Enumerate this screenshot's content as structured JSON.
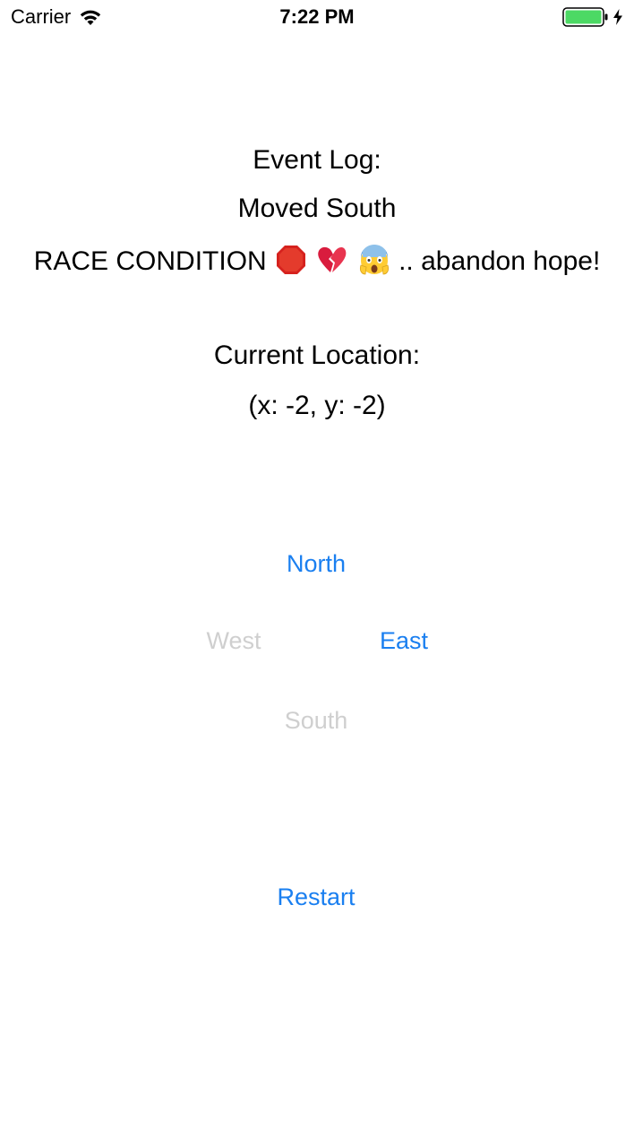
{
  "status_bar": {
    "carrier": "Carrier",
    "time": "7:22 PM",
    "icons": [
      "wifi-icon",
      "battery-icon",
      "charging-bolt-icon"
    ],
    "battery_color": "#4cd964"
  },
  "event_log": {
    "heading": "Event Log:",
    "entries": [
      "Moved South",
      {
        "before": "RACE CONDITION",
        "emojis": [
          "stop-sign-emoji",
          "broken-heart-emoji",
          "screaming-face-emoji"
        ],
        "after": ".. abandon hope!"
      }
    ]
  },
  "location": {
    "heading": "Current Location:",
    "value": "(x: -2, y: -2)"
  },
  "controls": {
    "north": {
      "label": "North",
      "enabled": true
    },
    "west": {
      "label": "West",
      "enabled": false
    },
    "east": {
      "label": "East",
      "enabled": true
    },
    "south": {
      "label": "South",
      "enabled": false
    },
    "restart": {
      "label": "Restart",
      "enabled": true
    }
  },
  "colors": {
    "accent": "#1a7ff0",
    "disabled": "#cfcfcf",
    "text": "#000000"
  }
}
